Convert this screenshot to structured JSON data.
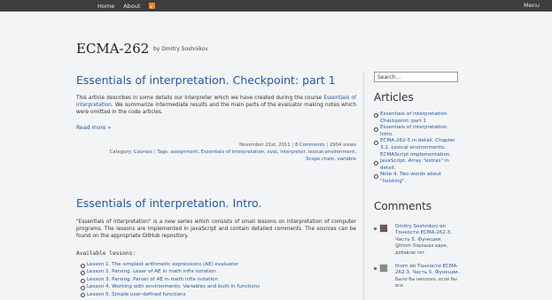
{
  "topbar": {
    "home": "Home",
    "about": "About",
    "menu": "Menu",
    "rss_icon": "rss-icon"
  },
  "blog": {
    "title": "ECMA-262",
    "byline": "by Dmitry Soshnikov"
  },
  "post1": {
    "title": "Essentials of interpretation. Checkpoint: part 1",
    "text_before": "This article describes in some details our interpreter which we have created during the course ",
    "text_link": "Essentials of interpretation",
    "text_after": ". We summarize intermediate results and the main parts of the evaluator making notes which were omitted in the code articles.",
    "read_more": "Read more »",
    "date": "November 21st, 2011",
    "comments": "8 Comments",
    "views": "2904 views",
    "category_label": "Category:",
    "category": "Courses",
    "tags_label": "Tags:",
    "tags": [
      "assignment",
      "Essentials of interpretation",
      "eval",
      "interpreter",
      "lexical environment",
      "Scope chain",
      "variable"
    ]
  },
  "post2": {
    "title": "Essentials of interpretation. Intro.",
    "text": "\"Essentials of interpretation\" is a new series which consists of small lessons on interpretation of computer programs. The lessons are implemented in JavaScript and contain detailed comments. The sources can be found on the appropriate GitHub repository.",
    "available": "Available lessons:",
    "lessons": [
      "Lesson 1. The simplest arithmetic expressions (AE) evaluator",
      "Lesson 2. Parsing. Lexer of AE in math infix notation",
      "Lesson 3. Parsing. Parser of AE in math infix notation",
      "Lesson 4. Working with environments. Variables and built-in functions",
      "Lesson 5. Simple user-defined functions"
    ]
  },
  "sidebar": {
    "search_value": "Search...",
    "articles_title": "Articles",
    "articles": [
      "Essentials of interpretation. Checkpoint: part 1",
      "Essentials of interpretation. Intro.",
      "ECMA-262-5 in detail. Chapter 3.2. Lexical environments: ECMAScript implementation.",
      "JavaScript. Array \"extras\" in detail.",
      "Note 4. Two words about \"hoisting\"."
    ],
    "comments_title": "Comments",
    "comments": [
      {
        "author": "Dmitry Soshnikov",
        "on": "on",
        "target": "Тонкости ECMA-262-3. Часть 5. Функции.",
        "excerpt": "@thorn Хорошая идея, добавлю тег."
      },
      {
        "author": "thorn",
        "on": "on",
        "target": "Тонкости ECMA-262-3. Часть 5. Функции.",
        "excerpt": "Было бы неплохо, если бы все"
      }
    ]
  }
}
